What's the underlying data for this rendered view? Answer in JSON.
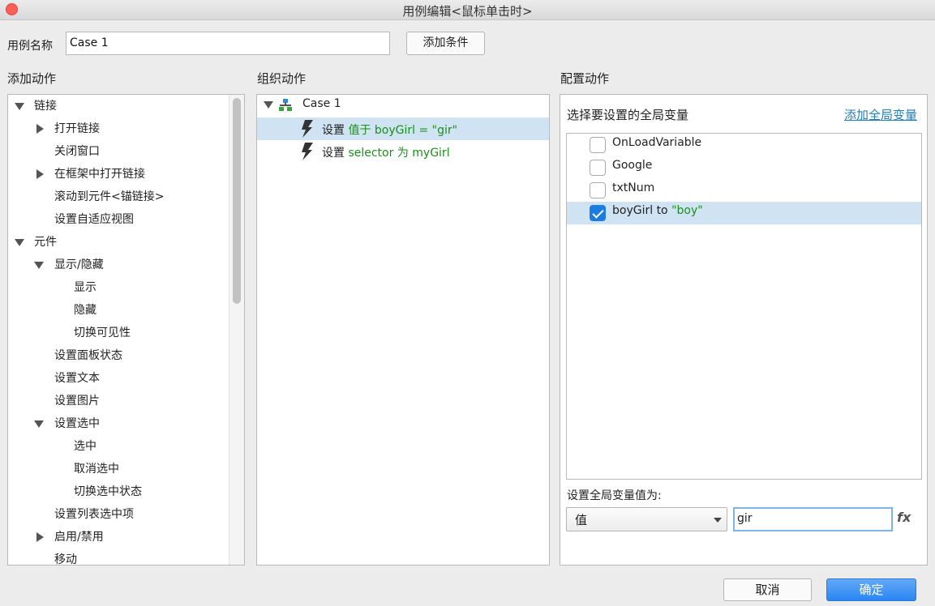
{
  "window": {
    "title": "用例编辑<鼠标单击时>"
  },
  "case_name": {
    "label": "用例名称",
    "value": "Case 1",
    "add_condition": "添加条件"
  },
  "add_action": {
    "heading": "添加动作",
    "items": [
      {
        "label": "链接"
      },
      {
        "label": "打开链接"
      },
      {
        "label": "关闭窗口"
      },
      {
        "label": "在框架中打开链接"
      },
      {
        "label": "滚动到元件<锚链接>"
      },
      {
        "label": "设置自适应视图"
      },
      {
        "label": "元件"
      },
      {
        "label": "显示/隐藏"
      },
      {
        "label": "显示"
      },
      {
        "label": "隐藏"
      },
      {
        "label": "切换可见性"
      },
      {
        "label": "设置面板状态"
      },
      {
        "label": "设置文本"
      },
      {
        "label": "设置图片"
      },
      {
        "label": "设置选中"
      },
      {
        "label": "选中"
      },
      {
        "label": "取消选中"
      },
      {
        "label": "切换选中状态"
      },
      {
        "label": "设置列表选中项"
      },
      {
        "label": "启用/禁用"
      },
      {
        "label": "移动"
      }
    ]
  },
  "organize_action": {
    "heading": "组织动作",
    "case_label": "Case 1",
    "actions": [
      {
        "prefix": "设置",
        "detail": "值于 boyGirl = \"gir\""
      },
      {
        "prefix": "设置",
        "detail": "selector 为 myGirl"
      }
    ]
  },
  "configure_action": {
    "heading": "配置动作",
    "select_label": "选择要设置的全局变量",
    "add_global_link": "添加全局变量",
    "variables": [
      {
        "name": "OnLoadVariable",
        "checked": false,
        "value_text": ""
      },
      {
        "name": "Google",
        "checked": false,
        "value_text": ""
      },
      {
        "name": "txtNum",
        "checked": false,
        "value_text": ""
      },
      {
        "name": "boyGirl to ",
        "checked": true,
        "value_text": "\"boy\""
      }
    ],
    "set_value_label": "设置全局变量值为:",
    "value_type": "值",
    "value_input": "gir",
    "fx_label": "fx"
  },
  "footer": {
    "cancel": "取消",
    "ok": "确定"
  }
}
